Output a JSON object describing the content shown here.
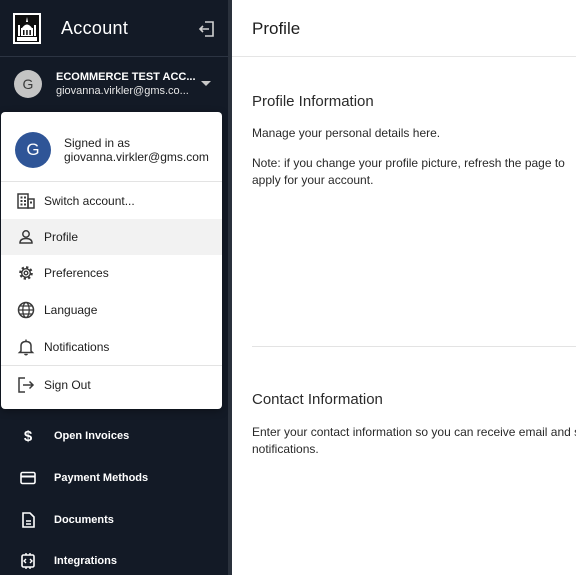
{
  "sidebar": {
    "title": "Account",
    "account": {
      "avatar_letter": "G",
      "name": "ECOMMERCE TEST ACC...",
      "email": "giovanna.virkler@gms.co..."
    },
    "nav": [
      {
        "label": "Open Invoices",
        "icon": "dollar-icon"
      },
      {
        "label": "Payment Methods",
        "icon": "credit-card-icon"
      },
      {
        "label": "Documents",
        "icon": "document-icon"
      },
      {
        "label": "Integrations",
        "icon": "integrations-icon"
      }
    ]
  },
  "menu": {
    "avatar_letter": "G",
    "signed_in_label": "Signed in as",
    "email": "giovanna.virkler@gms.com",
    "items": [
      {
        "label": "Switch account...",
        "icon": "building-icon"
      },
      {
        "label": "Profile",
        "icon": "person-icon",
        "active": true
      },
      {
        "label": "Preferences",
        "icon": "gear-icon"
      },
      {
        "label": "Language",
        "icon": "globe-icon"
      },
      {
        "label": "Notifications",
        "icon": "bell-icon"
      },
      {
        "label": "Sign Out",
        "icon": "sign-out-icon"
      }
    ]
  },
  "main": {
    "title": "Profile",
    "profile_section": {
      "title": "Profile Information",
      "desc": "Manage your personal details here.",
      "note_line1": "Note: if you change your profile picture, refresh the page to",
      "note_line2": "apply for your account."
    },
    "contact_section": {
      "title": "Contact Information",
      "desc_line1": "Enter your contact information so you can receive email and s",
      "desc_line2": "notifications."
    }
  }
}
